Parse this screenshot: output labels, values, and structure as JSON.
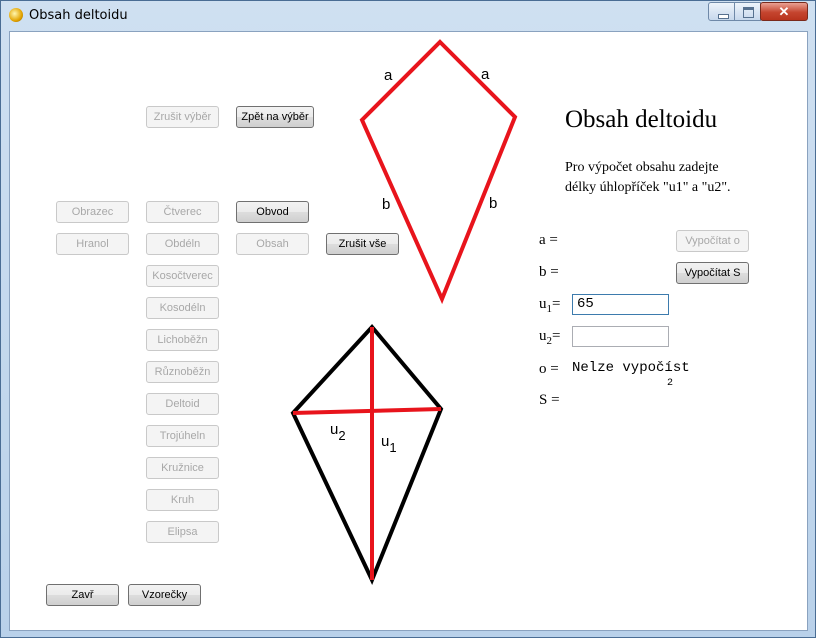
{
  "window": {
    "title": "Obsah deltoidu",
    "close_glyph": "✕"
  },
  "heading": "Obsah deltoidu",
  "description": {
    "line1": "Pro výpočet obsahu zadejte",
    "line2": "délky úhlopříček \"u1\" a \"u2\"."
  },
  "buttons": {
    "zrusit_vyber": "Zrušit výběr",
    "zpet_na_vyber": "Zpět na výběr",
    "zrusit_vse": "Zrušit vše",
    "zavri": "Zavř",
    "vzorecky": "Vzorečky",
    "vypocitat_o": "Vypočítat o",
    "vypocitat_s": "Vypočítat S"
  },
  "category_buttons": {
    "obrazec": "Obrazec",
    "hranol": "Hranol",
    "obvod": "Obvod",
    "obsah": "Obsah"
  },
  "shape_buttons": [
    "Čtverec",
    "Obdéln",
    "Kosočtverec",
    "Kosodéln",
    "Lichoběžn",
    "Různoběžn",
    "Deltoid",
    "Trojúheln",
    "Kružnice",
    "Kruh",
    "Elipsa"
  ],
  "labels": {
    "a": "a =",
    "b": "b =",
    "u1_prefix": "u",
    "u1_sub": "1",
    "u1_suffix": "=",
    "u2_prefix": "u",
    "u2_sub": "2",
    "u2_suffix": "=",
    "o": "o =",
    "S": "S ="
  },
  "inputs": {
    "u1_value": "65",
    "u2_value": ""
  },
  "results": {
    "o": "Nelze vypočíst",
    "s_superscript": "2"
  },
  "diagram_top": {
    "side_a": "a",
    "side_b": "b",
    "color": "#e8141c"
  },
  "diagram_bottom": {
    "u2": "u",
    "u2_sub": "2",
    "u1": "u",
    "u1_sub": "1",
    "outline_color": "#000000",
    "diagonal_color": "#e8141c"
  }
}
